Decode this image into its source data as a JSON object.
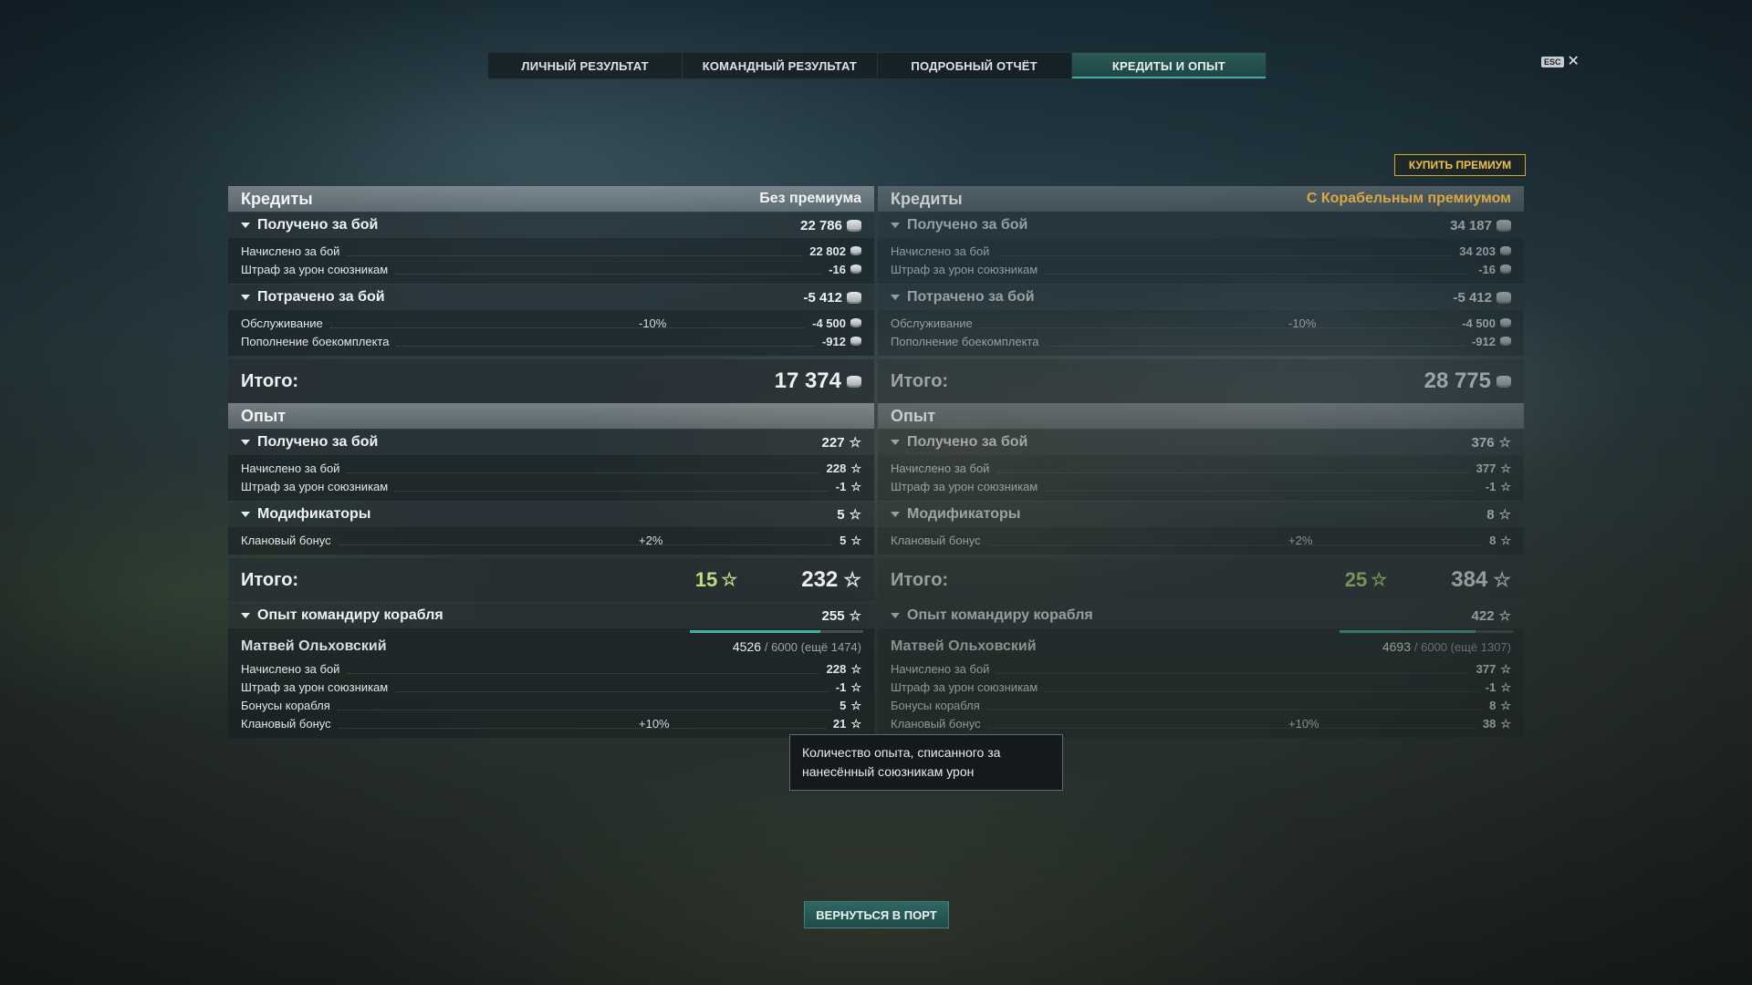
{
  "tabs": [
    {
      "label": "ЛИЧНЫЙ РЕЗУЛЬТАТ",
      "active": false
    },
    {
      "label": "КОМАНДНЫЙ РЕЗУЛЬТАТ",
      "active": false
    },
    {
      "label": "ПОДРОБНЫЙ ОТЧЁТ",
      "active": false
    },
    {
      "label": "КРЕДИТЫ И ОПЫТ",
      "active": true
    }
  ],
  "esc_label": "ESC",
  "buy_premium_label": "КУПИТЬ ПРЕМИУМ",
  "left": {
    "credits": {
      "title": "Кредиты",
      "subtitle": "Без премиума",
      "earned": {
        "label": "Получено за бой",
        "value": "22 786",
        "rows": [
          {
            "name": "Начислено за бой",
            "pct": "",
            "value": "22 802"
          },
          {
            "name": "Штраф за урон союзникам",
            "pct": "",
            "value": "-16"
          }
        ]
      },
      "spent": {
        "label": "Потрачено за бой",
        "value": "-5 412",
        "rows": [
          {
            "name": "Обслуживание",
            "pct": "-10%",
            "value": "-4 500"
          },
          {
            "name": "Пополнение боекомплекта",
            "pct": "",
            "value": "-912"
          }
        ]
      },
      "total_label": "Итого:",
      "total": "17 374"
    },
    "xp": {
      "title": "Опыт",
      "earned": {
        "label": "Получено за бой",
        "value": "227",
        "rows": [
          {
            "name": "Начислено за бой",
            "pct": "",
            "value": "228"
          },
          {
            "name": "Штраф за урон союзникам",
            "pct": "",
            "value": "-1"
          }
        ]
      },
      "modifiers": {
        "label": "Модификаторы",
        "value": "5",
        "rows": [
          {
            "name": "Клановый бонус",
            "pct": "+2%",
            "value": "5"
          }
        ]
      },
      "total_label": "Итого:",
      "total_bonus": "15",
      "total": "232"
    },
    "commander": {
      "label": "Опыт командиру корабля",
      "value": "255",
      "name": "Матвей Ольховский",
      "progress": 0.7543,
      "xp_current": "4526",
      "xp_rest": "/ 6000 (ещё 1474)",
      "rows": [
        {
          "name": "Начислено за бой",
          "pct": "",
          "value": "228"
        },
        {
          "name": "Штраф за урон союзникам",
          "pct": "",
          "value": "-1"
        },
        {
          "name": "Бонусы корабля",
          "pct": "",
          "value": "5"
        },
        {
          "name": "Клановый бонус",
          "pct": "+10%",
          "value": "21"
        }
      ]
    }
  },
  "right": {
    "credits": {
      "title": "Кредиты",
      "subtitle": "С Корабельным премиумом",
      "earned": {
        "label": "Получено за бой",
        "value": "34 187",
        "rows": [
          {
            "name": "Начислено за бой",
            "pct": "",
            "value": "34 203"
          },
          {
            "name": "Штраф за урон союзникам",
            "pct": "",
            "value": "-16"
          }
        ]
      },
      "spent": {
        "label": "Потрачено за бой",
        "value": "-5 412",
        "rows": [
          {
            "name": "Обслуживание",
            "pct": "-10%",
            "value": "-4 500"
          },
          {
            "name": "Пополнение боекомплекта",
            "pct": "",
            "value": "-912"
          }
        ]
      },
      "total_label": "Итого:",
      "total": "28 775"
    },
    "xp": {
      "title": "Опыт",
      "earned": {
        "label": "Получено за бой",
        "value": "376",
        "rows": [
          {
            "name": "Начислено за бой",
            "pct": "",
            "value": "377"
          },
          {
            "name": "Штраф за урон союзникам",
            "pct": "",
            "value": "-1"
          }
        ]
      },
      "modifiers": {
        "label": "Модификаторы",
        "value": "8",
        "rows": [
          {
            "name": "Клановый бонус",
            "pct": "+2%",
            "value": "8"
          }
        ]
      },
      "total_label": "Итого:",
      "total_bonus": "25",
      "total": "384"
    },
    "commander": {
      "label": "Опыт командиру корабля",
      "value": "422",
      "name": "Матвей Ольховский",
      "progress": 0.7822,
      "xp_current": "4693",
      "xp_rest": "/ 6000 (ещё 1307)",
      "rows": [
        {
          "name": "Начислено за бой",
          "pct": "",
          "value": "377"
        },
        {
          "name": "Штраф за урон союзникам",
          "pct": "",
          "value": "-1"
        },
        {
          "name": "Бонусы корабля",
          "pct": "",
          "value": "8"
        },
        {
          "name": "Клановый бонус",
          "pct": "+10%",
          "value": "38"
        }
      ]
    }
  },
  "tooltip": "Количество опыта, списанного за нанесённый союзникам урон",
  "return_label": "ВЕРНУТЬСЯ В ПОРТ",
  "colors": {
    "accent": "#3fb0a4",
    "premium": "#d9a844",
    "bonus_green": "#b9e07a"
  },
  "icons": {
    "credits": "coin-icon",
    "xp": "star-icon"
  }
}
